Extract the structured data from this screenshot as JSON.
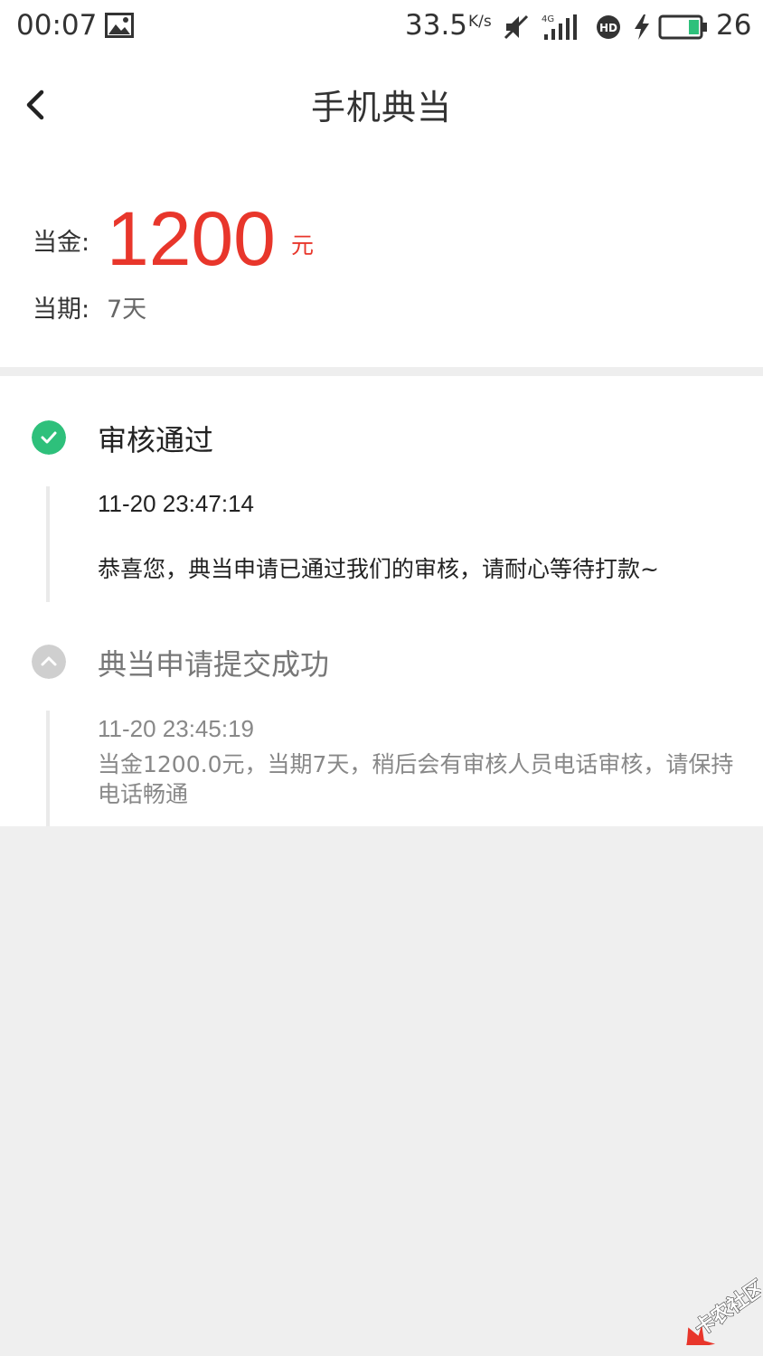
{
  "status_bar": {
    "time": "00:07",
    "net_speed": "33.5",
    "net_speed_unit": "K/s",
    "network_label": "4G",
    "battery_percent": "26",
    "icons": [
      "image-icon",
      "mute-icon",
      "signal-4g-icon",
      "hd-call-icon",
      "charging-icon",
      "battery-icon"
    ]
  },
  "header": {
    "title": "手机典当",
    "back_icon": "chevron-left-icon"
  },
  "pawn": {
    "amount_label": "当金:",
    "amount": "1200",
    "amount_unit": "元",
    "term_label": "当期:",
    "term": "7天"
  },
  "timeline": {
    "steps": [
      {
        "status": "done",
        "icon": "check-circle-icon",
        "title": "审核通过",
        "time": "11-20 23:47:14",
        "description": "恭喜您，典当申请已通过我们的审核，请耐心等待打款~"
      },
      {
        "status": "done-inactive",
        "icon": "chevron-up-circle-icon",
        "title": "典当申请提交成功",
        "time": "11-20 23:45:19",
        "description": "当金1200.0元，当期7天，稍后会有审核人员电话审核，请保持电话畅通"
      }
    ]
  },
  "watermark": {
    "text": "卡农社区"
  },
  "colors": {
    "accent_red": "#e8362b",
    "success_green": "#2ec07b",
    "inactive_gray": "#cfcfcf",
    "page_bg": "#efefef"
  }
}
